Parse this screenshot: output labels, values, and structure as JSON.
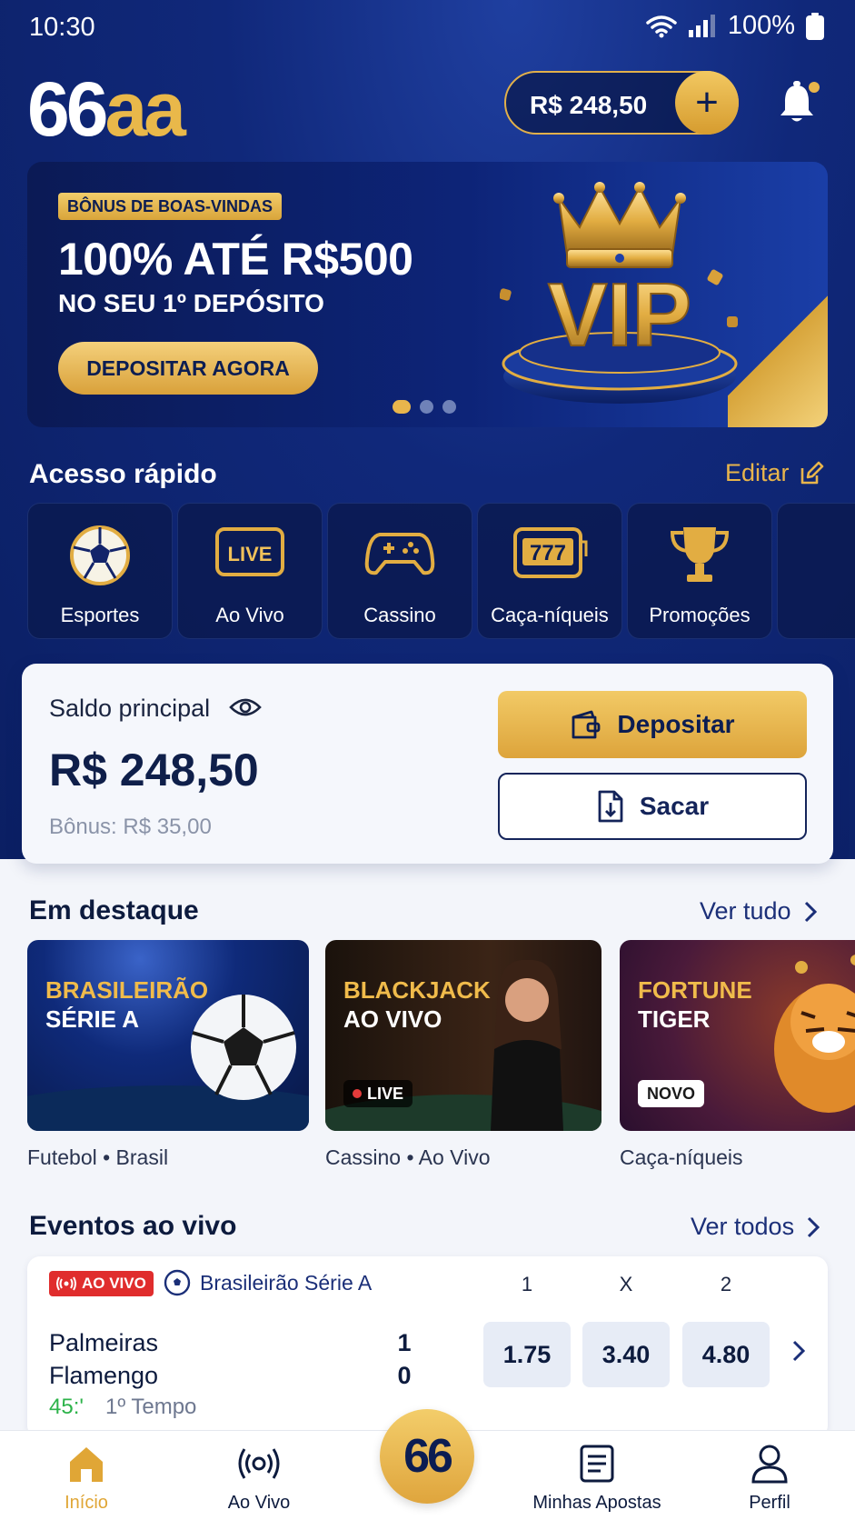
{
  "status_bar": {
    "time": "10:30",
    "battery": "100%"
  },
  "header": {
    "logo_white": "66",
    "logo_gold": "aa",
    "balance": "R$ 248,50",
    "add_icon": "plus-icon",
    "bell_icon": "bell-icon"
  },
  "banner": {
    "badge": "BÔNUS DE BOAS-VINDAS",
    "title": "100% ATÉ R$500",
    "subtitle": "NO SEU 1º DEPÓSITO",
    "cta": "DEPOSITAR AGORA",
    "art_text": "VIP",
    "slides": 3,
    "active_slide": 1
  },
  "quick_access": {
    "title": "Acesso rápido",
    "edit": "Editar",
    "items": [
      {
        "label": "Esportes",
        "icon": "soccer-ball-icon"
      },
      {
        "label": "Ao Vivo",
        "icon": "live-tv-icon",
        "icon_text": "LIVE"
      },
      {
        "label": "Cassino",
        "icon": "gamepad-icon"
      },
      {
        "label": "Caça-níqueis",
        "icon": "slot-machine-icon",
        "icon_text": "777"
      },
      {
        "label": "Promoções",
        "icon": "trophy-icon"
      }
    ]
  },
  "balance_card": {
    "label": "Saldo principal",
    "amount": "R$ 248,50",
    "bonus": "Bônus: R$ 35,00",
    "deposit": "Depositar",
    "withdraw": "Sacar"
  },
  "featured": {
    "title": "Em destaque",
    "see_all": "Ver tudo",
    "cards": [
      {
        "line1": "BRASILEIRÃO",
        "line2": "SÉRIE A",
        "sub": "Futebol • Brasil"
      },
      {
        "line1": "BLACKJACK",
        "line2": "AO VIVO",
        "sub": "Cassino • Ao Vivo",
        "chip": "LIVE"
      },
      {
        "line1": "FORTUNE",
        "line2": "TIGER",
        "sub": "Caça-níqueis",
        "chip": "NOVO"
      }
    ]
  },
  "live_events": {
    "title": "Eventos ao vivo",
    "see_all": "Ver todos",
    "event": {
      "badge": "AO VIVO",
      "league": "Brasileirão Série A",
      "headers": [
        "1",
        "X",
        "2"
      ],
      "home": "Palmeiras",
      "away": "Flamengo",
      "home_score": "1",
      "away_score": "0",
      "minute": "45:'",
      "period": "1º Tempo",
      "odds": [
        "1.75",
        "3.40",
        "4.80"
      ]
    }
  },
  "bottom_nav": {
    "items": [
      {
        "label": "Início",
        "icon": "home-icon",
        "active": true
      },
      {
        "label": "Ao Vivo",
        "icon": "broadcast-icon"
      },
      {
        "label": "Minhas Apostas",
        "icon": "ticket-icon"
      },
      {
        "label": "Perfil",
        "icon": "user-icon"
      }
    ],
    "center": "66"
  },
  "colors": {
    "navy": "#0b1f63",
    "gold": "#e8b54c",
    "live_red": "#e02d2d",
    "live_green": "#2db34a"
  }
}
